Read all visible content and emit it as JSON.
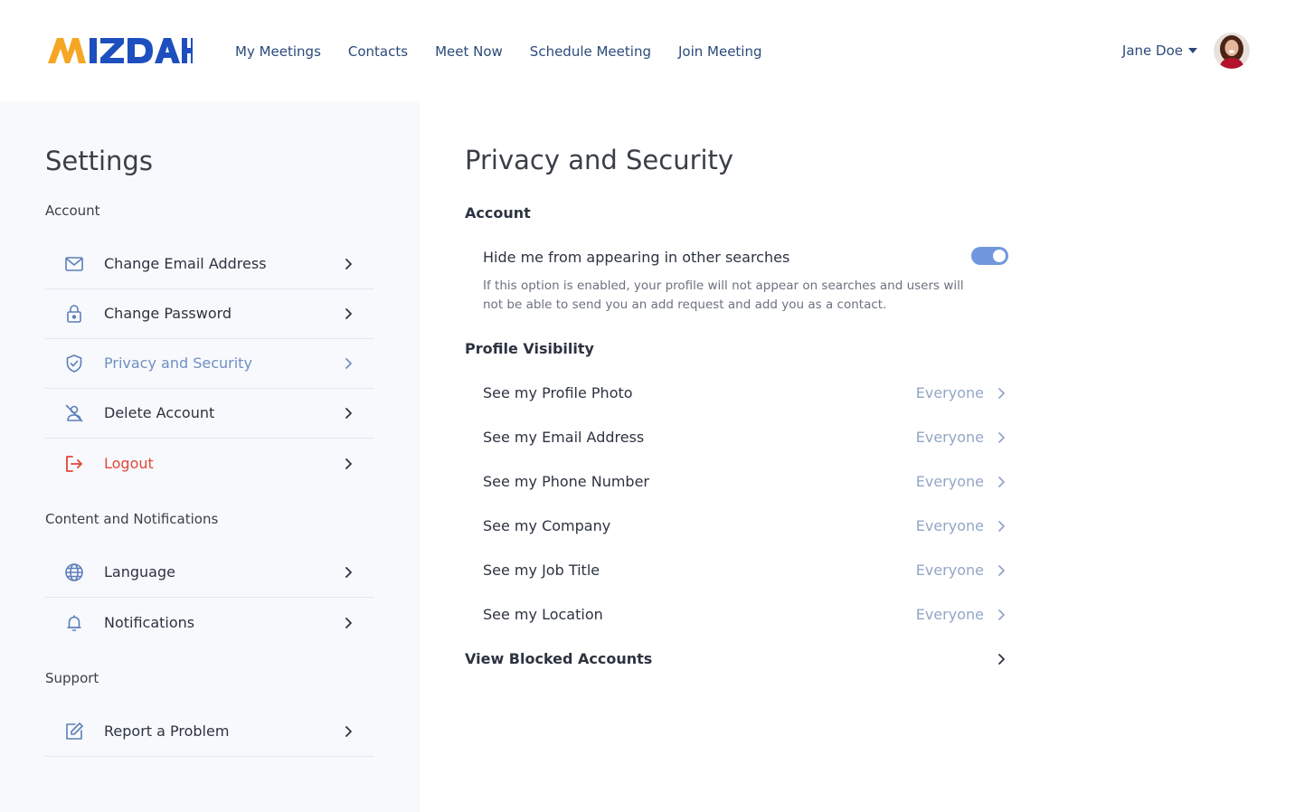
{
  "brand": {
    "logo_text": "MIZDAH",
    "colors": {
      "orange": "#f5a623",
      "blue": "#1e4fbf"
    }
  },
  "nav": {
    "items": [
      {
        "label": "My Meetings"
      },
      {
        "label": "Contacts"
      },
      {
        "label": "Meet Now"
      },
      {
        "label": "Schedule Meeting"
      },
      {
        "label": "Join Meeting"
      }
    ]
  },
  "user": {
    "name": "Jane Doe",
    "avatar_icon": "user-avatar"
  },
  "sidebar": {
    "title": "Settings",
    "sections": [
      {
        "heading": "Account",
        "items": [
          {
            "label": "Change Email Address",
            "icon": "mail-icon"
          },
          {
            "label": "Change Password",
            "icon": "lock-icon"
          },
          {
            "label": "Privacy and Security",
            "icon": "shield-check-icon",
            "state": "active"
          },
          {
            "label": "Delete Account",
            "icon": "user-off-icon"
          },
          {
            "label": "Logout",
            "icon": "logout-icon",
            "state": "danger"
          }
        ]
      },
      {
        "heading": "Content and Notifications",
        "items": [
          {
            "label": "Language",
            "icon": "globe-icon"
          },
          {
            "label": "Notifications",
            "icon": "bell-icon"
          }
        ]
      },
      {
        "heading": "Support",
        "items": [
          {
            "label": "Report a Problem",
            "icon": "edit-icon"
          }
        ]
      }
    ]
  },
  "main": {
    "title": "Privacy and Security",
    "account": {
      "heading": "Account",
      "toggle_label": "Hide me from appearing in other searches",
      "toggle_on": true,
      "toggle_desc": "If this option is enabled, your profile will not appear on searches and users will not be able to send you an add request and add you as a contact."
    },
    "visibility": {
      "heading": "Profile Visibility",
      "rows": [
        {
          "label": "See my Profile Photo",
          "value": "Everyone"
        },
        {
          "label": "See my Email Address",
          "value": "Everyone"
        },
        {
          "label": "See my Phone Number",
          "value": "Everyone"
        },
        {
          "label": "See my Company",
          "value": "Everyone"
        },
        {
          "label": "See my Job Title",
          "value": "Everyone"
        },
        {
          "label": "See my Location",
          "value": "Everyone"
        }
      ]
    },
    "blocked_label": "View Blocked Accounts"
  }
}
